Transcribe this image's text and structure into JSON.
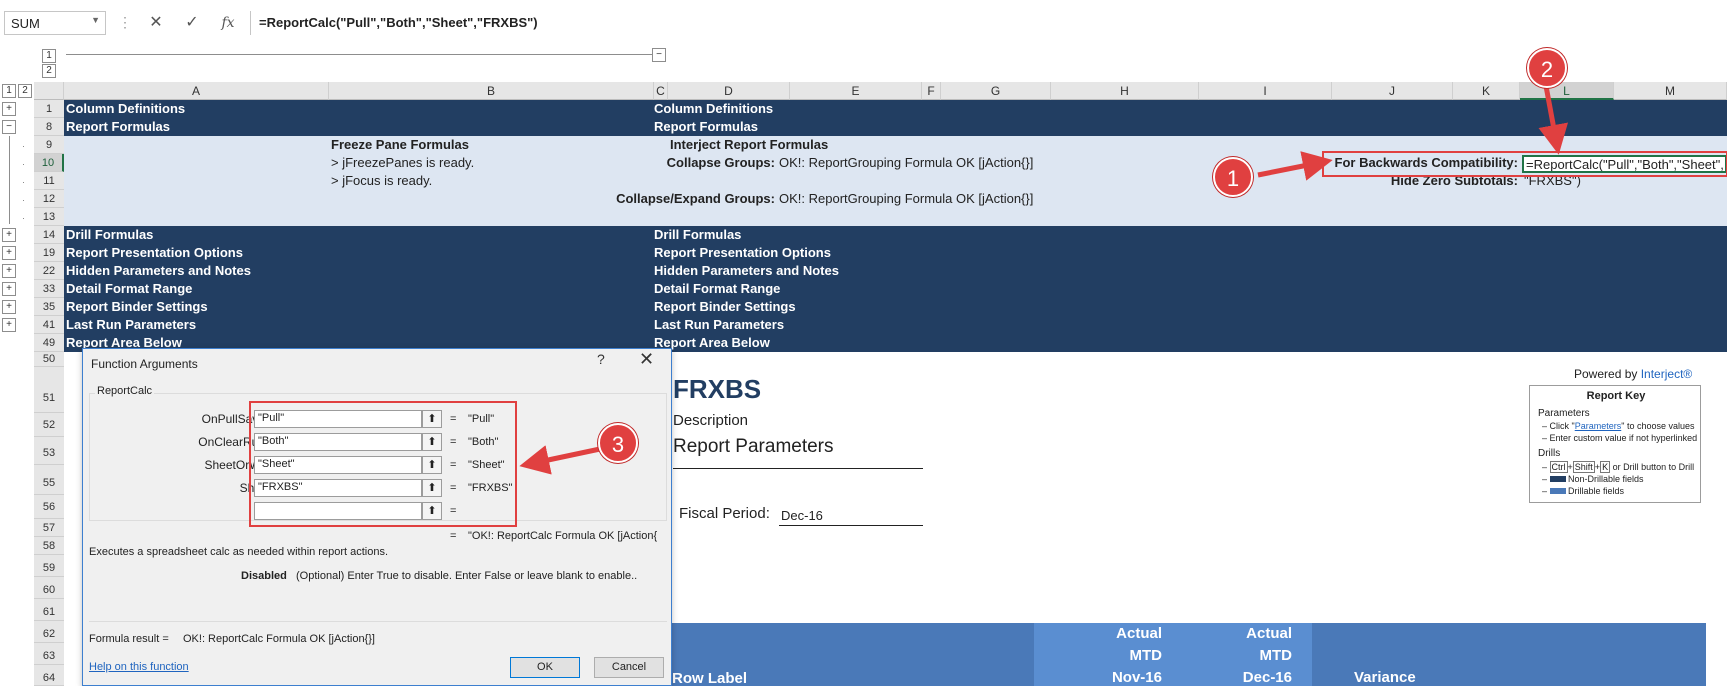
{
  "formula_bar": {
    "name_box": "SUM",
    "cancel_icon": "x",
    "enter_icon": "check",
    "function_label": "fx",
    "formula": "=ReportCalc(\"Pull\",\"Both\",\"Sheet\",\"FRXBS\")"
  },
  "outline": {
    "level_buttons_top": [
      "1",
      "2"
    ],
    "level_buttons_left": [
      "1",
      "2"
    ],
    "collapse_symbol": "−",
    "expand_symbol": "+"
  },
  "columns": [
    "A",
    "B",
    "C",
    "D",
    "E",
    "F",
    "G",
    "H",
    "I",
    "J",
    "K",
    "L",
    "M"
  ],
  "selected_column": "L",
  "rows": [
    {
      "num": "1",
      "a": "Column Definitions",
      "d": "Column Definitions"
    },
    {
      "num": "8",
      "a": "Report Formulas",
      "d": "Report Formulas"
    },
    {
      "num": "9",
      "b": "Freeze Pane Formulas",
      "d": "Interject Report Formulas"
    },
    {
      "num": "10",
      "b": "> jFreezePanes is ready.",
      "d_label": "Collapse Groups:",
      "e": "OK!: ReportGrouping Formula OK [jAction{}]",
      "k_label": "For Backwards Compatibility:",
      "l": "=ReportCalc(\"Pull\",\"Both\",\"Sheet\","
    },
    {
      "num": "11",
      "b": "> jFocus is ready.",
      "k_label": "Hide Zero Subtotals:",
      "l": "\"FRXBS\")"
    },
    {
      "num": "12",
      "d_label": "Collapse/Expand Groups:",
      "e": "OK!: ReportGrouping Formula OK [jAction{}]"
    },
    {
      "num": "13"
    },
    {
      "num": "14",
      "a": "Drill Formulas",
      "d": "Drill Formulas"
    },
    {
      "num": "19",
      "a": "Report Presentation Options",
      "d": "Report Presentation Options"
    },
    {
      "num": "22",
      "a": "Hidden Parameters and Notes",
      "d": "Hidden Parameters and Notes"
    },
    {
      "num": "33",
      "a": "Detail Format Range",
      "d": "Detail Format Range"
    },
    {
      "num": "35",
      "a": "Report Binder Settings",
      "d": "Report Binder Settings"
    },
    {
      "num": "41",
      "a": "Last Run Parameters",
      "d": "Last Run Parameters"
    },
    {
      "num": "49",
      "a": "Report Area Below",
      "d": "Report Area Below"
    },
    {
      "num": "50"
    },
    {
      "num": "51"
    },
    {
      "num": "52"
    },
    {
      "num": "53"
    },
    {
      "num": "55"
    },
    {
      "num": "56"
    },
    {
      "num": "57"
    },
    {
      "num": "58"
    },
    {
      "num": "59"
    },
    {
      "num": "60"
    },
    {
      "num": "61"
    },
    {
      "num": "62"
    },
    {
      "num": "63"
    },
    {
      "num": "64"
    }
  ],
  "report": {
    "powered_by": "Powered by",
    "powered_by_brand": "Interject®",
    "title": "FRXBS",
    "description": "Description",
    "parameters_heading": "Report Parameters",
    "fiscal_period_label": "Fiscal Period:",
    "fiscal_period_value": "Dec-16",
    "table_headers": {
      "row_label": "Row Label",
      "col1_line1": "Actual",
      "col1_line2": "MTD",
      "col1_line3": "Nov-16",
      "col2_line1": "Actual",
      "col2_line2": "MTD",
      "col2_line3": "Dec-16",
      "variance": "Variance"
    }
  },
  "report_key": {
    "title": "Report Key",
    "parameters_heading": "Parameters",
    "param_line1_pre": "Click \"",
    "param_line1_link": "Parameters",
    "param_line1_post": "\" to choose values",
    "param_line2": "Enter custom value if not hyperlinked",
    "drills_heading": "Drills",
    "key_ctrl": "Ctrl",
    "key_shift": "Shift",
    "key_k": "K",
    "drill_line1_post": "or Drill button to Drill",
    "drill_line2": "Non-Drillable fields",
    "drill_line3": "Drillable fields"
  },
  "dialog": {
    "title": "Function Arguments",
    "help_glyph": "?",
    "close_glyph": "✕",
    "function_name": "ReportCalc",
    "arguments": [
      {
        "label": "OnPullSaveOrBoth",
        "value": "\"Pull\"",
        "result": "\"Pull\""
      },
      {
        "label": "OnClearRunOrBoth",
        "value": "\"Both\"",
        "result": "\"Both\""
      },
      {
        "label": "SheetOrWorkbook",
        "value": "\"Sheet\"",
        "result": "\"Sheet\""
      },
      {
        "label": "SheetName",
        "value": "\"FRXBS\"",
        "result": "\"FRXBS\""
      },
      {
        "label": "Disabled",
        "value": "",
        "result": ""
      }
    ],
    "equals": "=",
    "overall_result": "\"OK!: ReportCalc Formula OK [jAction{",
    "description": "Executes a spreadsheet calc as needed within report actions.",
    "arg_help_name": "Disabled",
    "arg_help_text": "(Optional) Enter True to disable.  Enter False or leave blank to enable..",
    "formula_result_label": "Formula result =",
    "formula_result_value": "OK!: ReportCalc Formula OK [jAction{}]",
    "help_link": "Help on this function",
    "ok": "OK",
    "cancel": "Cancel"
  },
  "annotations": {
    "marker1": "1",
    "marker2": "2",
    "marker3": "3",
    "color": "#e04040"
  },
  "colors": {
    "dark_band": "#223e62",
    "light_band": "#dde6f2",
    "report_header_bg": "#4a79b8",
    "excel_green": "#217346"
  }
}
